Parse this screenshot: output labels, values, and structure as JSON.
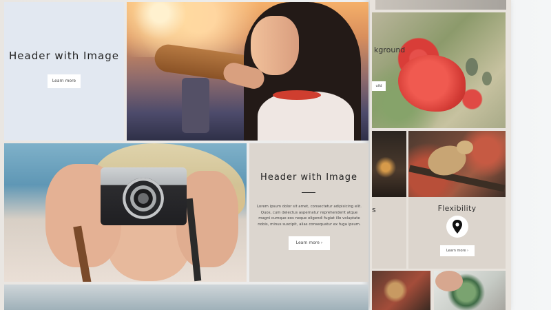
{
  "background_page": {
    "header_text": "kground",
    "small_button_label": "uild",
    "left_card_letter": "s",
    "flexibility": {
      "title": "Flexibility",
      "icon": "map-pin-icon",
      "button_label": "Learn more ›"
    }
  },
  "main_page": {
    "top_left_card": {
      "title": "Header with Image",
      "button_label": "Learn more"
    },
    "middle_right_card": {
      "title": "Header with Image",
      "body": "Lorem ipsum dolor sit amet, consectetur adipisicing elit. Quos, cum delectus aspernatur reprehenderit atque magni cumque eos neque eligendi fugiat illo voluptate nobis, minus suscipit, alias consequatur ex fuga ipsum.",
      "button_label": "Learn more ›"
    }
  }
}
